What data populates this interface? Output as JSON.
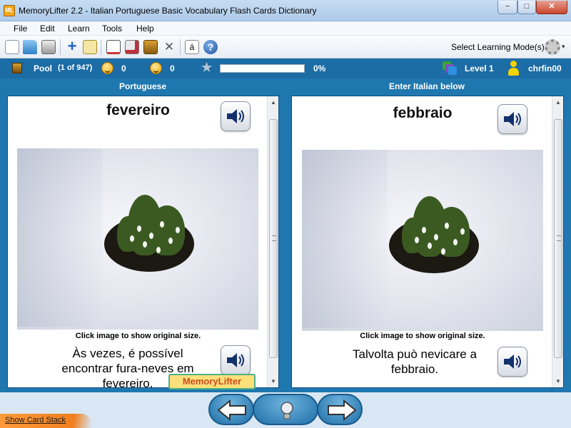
{
  "window": {
    "title": "MemoryLifter 2.2 - Italian Portuguese Basic Vocabulary Flash Cards Dictionary",
    "logo": "ML",
    "min": "−",
    "max": "□",
    "close": "✕"
  },
  "menu": [
    {
      "label": "File"
    },
    {
      "label": "Edit"
    },
    {
      "label": "Learn"
    },
    {
      "label": "Tools"
    },
    {
      "label": "Help"
    }
  ],
  "toolbar": {
    "icons": [
      "new-document-icon",
      "open-folder-icon",
      "print-icon",
      "add-card-icon",
      "edit-card-icon",
      "presentation-icon",
      "card-stack-icon",
      "pool-box-icon",
      "settings-tools-icon",
      "special-character-icon",
      "help-icon"
    ],
    "special_char": "á",
    "help": "?",
    "mode_label": "Select Learning Mode(s)",
    "mode_arrow": "▾"
  },
  "status": {
    "pool_label": "Pool",
    "pool_count": "(1 of 947)",
    "right_count": "0",
    "wrong_count": "0",
    "progress_text": "0%",
    "progress_fraction": 0.0,
    "level": "Level 1",
    "user": "chrfin00",
    "star": "★"
  },
  "left_card": {
    "header": "Portuguese",
    "word": "fevereiro",
    "caption": "Click image to show original size.",
    "sentence": "Às vezes, é possível encontrar fura-neves em fevereiro."
  },
  "right_card": {
    "header": "Enter Italian below",
    "word": "febbraio",
    "caption": "Click image to show original size.",
    "sentence": "Talvolta può nevicare a febbraio."
  },
  "logo_overlay": "MemoryLifter",
  "bottom": {
    "show_card_stack": "Show Card Stack"
  },
  "colors": {
    "main_bg": "#1f77af",
    "status_bg": "#1c6ca5",
    "accent_orange": "#f07f1e"
  }
}
